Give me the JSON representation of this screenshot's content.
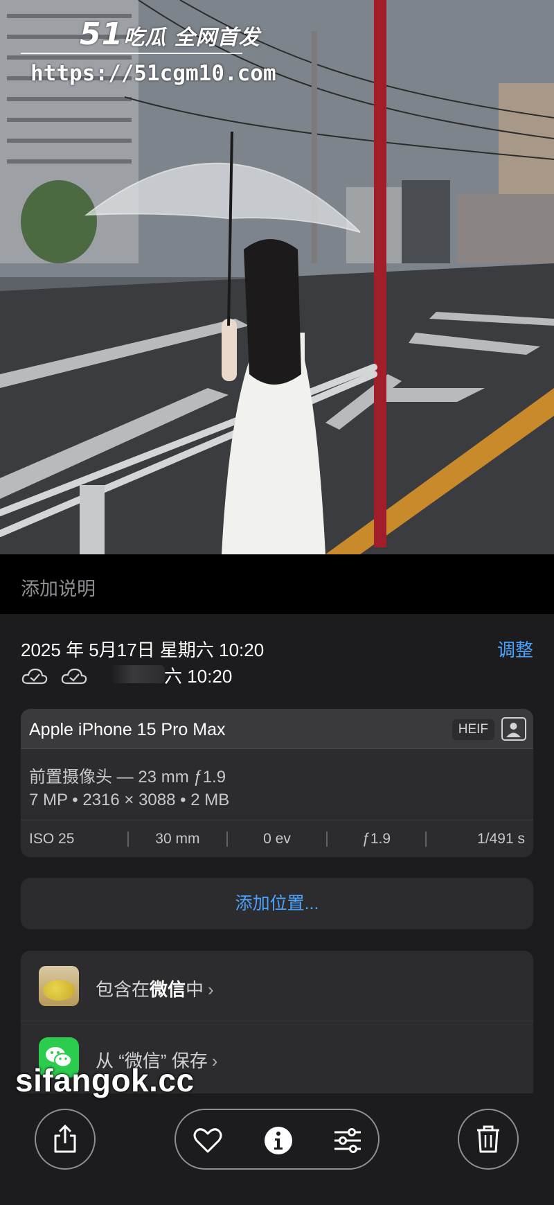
{
  "watermarks": {
    "brand_num": "51",
    "brand_text": "吃瓜 全网首发",
    "url": "https://51cgm10.com",
    "overlay": "sifangok.cc"
  },
  "caption": {
    "placeholder": "添加说明"
  },
  "datetime": {
    "main": "2025 年 5月17日  星期六  10:20",
    "sub": "六 10:20",
    "adjust_label": "调整"
  },
  "camera": {
    "model": "Apple iPhone 15 Pro Max",
    "format_badge": "HEIF",
    "lens": "前置摄像头 — 23 mm ƒ1.9",
    "specs": "7 MP • 2316 × 3088 • 2 MB",
    "exif": [
      "ISO 25",
      "30 mm",
      "0 ev",
      "ƒ1.9",
      "1/491 s"
    ]
  },
  "location": {
    "add_label": "添加位置..."
  },
  "sharing": {
    "included_prefix": "包含在",
    "included_app": "微信",
    "included_suffix": "中",
    "saved_prefix": "从 “",
    "saved_app": "微信",
    "saved_suffix": "” 保存",
    "chevron": "›"
  },
  "toolbar": {
    "share": "share-icon",
    "favorite": "heart-icon",
    "info": "info-icon",
    "adjust": "sliders-icon",
    "delete": "trash-icon"
  },
  "colors": {
    "accent": "#4aa3ff",
    "panel": "#1c1c1e",
    "card": "#2c2c2e",
    "wechat": "#2ccc4f"
  }
}
